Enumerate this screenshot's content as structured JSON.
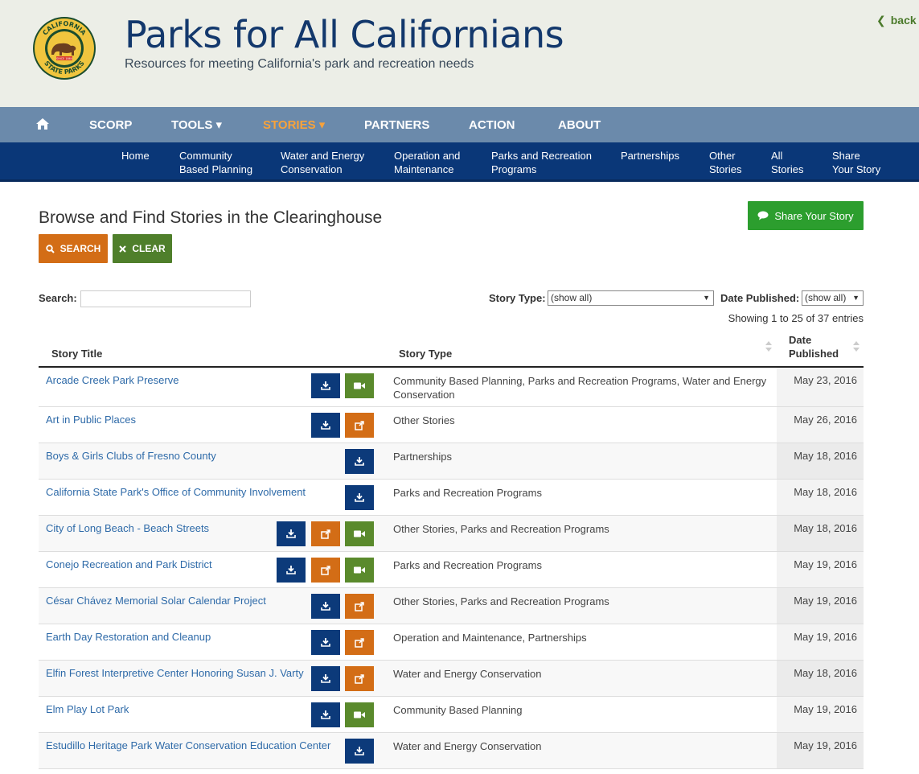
{
  "header": {
    "title": "Parks for All Californians",
    "subtitle": "Resources for meeting California's park and recreation needs",
    "back_label": "back t",
    "logo_text_top": "CALIFORNIA",
    "logo_text_bottom": "STATE PARKS",
    "logo_since": "SINCE 1864"
  },
  "mainnav": {
    "items": [
      {
        "label": "SCORP"
      },
      {
        "label": "TOOLS ▾"
      },
      {
        "label": "STORIES ▾"
      },
      {
        "label": "PARTNERS"
      },
      {
        "label": "ACTION"
      },
      {
        "label": "ABOUT"
      }
    ]
  },
  "subnav": {
    "items": [
      {
        "line1": "Home",
        "line2": ""
      },
      {
        "line1": "Community",
        "line2": "Based Planning"
      },
      {
        "line1": "Water and Energy",
        "line2": "Conservation"
      },
      {
        "line1": "Operation and",
        "line2": "Maintenance"
      },
      {
        "line1": "Parks and Recreation",
        "line2": "Programs"
      },
      {
        "line1": "Partnerships",
        "line2": ""
      },
      {
        "line1": "Other",
        "line2": "Stories"
      },
      {
        "line1": "All",
        "line2": "Stories"
      },
      {
        "line1": "Share",
        "line2": "Your Story"
      }
    ]
  },
  "content": {
    "heading": "Browse and Find Stories in the Clearinghouse",
    "search_button": "SEARCH",
    "clear_button": "CLEAR",
    "share_button": "Share Your Story",
    "search_label": "Search:",
    "search_value": "",
    "story_type_label": "Story Type:",
    "story_type_value": "(show all)",
    "date_label": "Date Published:",
    "date_value": "(show all)",
    "showing": "Showing 1 to 25 of 37 entries"
  },
  "table": {
    "headers": {
      "title": "Story Title",
      "type": "Story Type",
      "date_line1": "Date",
      "date_line2": "Published"
    },
    "rows": [
      {
        "title": "Arcade Creek Park Preserve",
        "type": "Community Based Planning, Parks and Recreation Programs, Water and Energy Conservation",
        "date": "May 23, 2016",
        "icons": [
          "download-icon",
          "video-icon"
        ]
      },
      {
        "title": "Art in Public Places",
        "type": "Other Stories",
        "date": "May 26, 2016",
        "icons": [
          "download-icon",
          "external-link-icon"
        ]
      },
      {
        "title": "Boys & Girls Clubs of Fresno County",
        "type": "Partnerships",
        "date": "May 18, 2016",
        "icons": [
          "download-icon"
        ]
      },
      {
        "title": "California State Park's Office of Community Involvement",
        "type": "Parks and Recreation Programs",
        "date": "May 18, 2016",
        "icons": [
          "download-icon"
        ]
      },
      {
        "title": "City of Long Beach - Beach Streets",
        "type": "Other Stories, Parks and Recreation Programs",
        "date": "May 18, 2016",
        "icons": [
          "download-icon",
          "external-link-icon",
          "video-icon"
        ]
      },
      {
        "title": "Conejo Recreation and Park District",
        "type": "Parks and Recreation Programs",
        "date": "May 19, 2016",
        "icons": [
          "download-icon",
          "external-link-icon",
          "video-icon"
        ]
      },
      {
        "title": "César Chávez Memorial Solar Calendar Project",
        "type": "Other Stories, Parks and Recreation Programs",
        "date": "May 19, 2016",
        "icons": [
          "download-icon",
          "external-link-icon"
        ]
      },
      {
        "title": "Earth Day Restoration and Cleanup",
        "type": "Operation and Maintenance, Partnerships",
        "date": "May 19, 2016",
        "icons": [
          "download-icon",
          "external-link-icon"
        ]
      },
      {
        "title": "Elfin Forest Interpretive Center Honoring Susan J. Varty",
        "type": "Water and Energy Conservation",
        "date": "May 18, 2016",
        "icons": [
          "download-icon",
          "external-link-icon"
        ]
      },
      {
        "title": "Elm Play Lot Park",
        "type": "Community Based Planning",
        "date": "May 19, 2016",
        "icons": [
          "download-icon",
          "video-icon"
        ]
      },
      {
        "title": "Estudillo Heritage Park Water Conservation Education Center",
        "type": "Water and Energy Conservation",
        "date": "May 19, 2016",
        "icons": [
          "download-icon"
        ]
      }
    ]
  },
  "colors": {
    "title_blue": "#13386c",
    "nav_light": "#6b8aab",
    "nav_dark": "#0a3778",
    "active_orange": "#f7a23b",
    "search_orange": "#d36d16",
    "clear_green": "#4f7f2b",
    "share_green": "#2c9e2e",
    "link_blue": "#2e6aa8"
  }
}
